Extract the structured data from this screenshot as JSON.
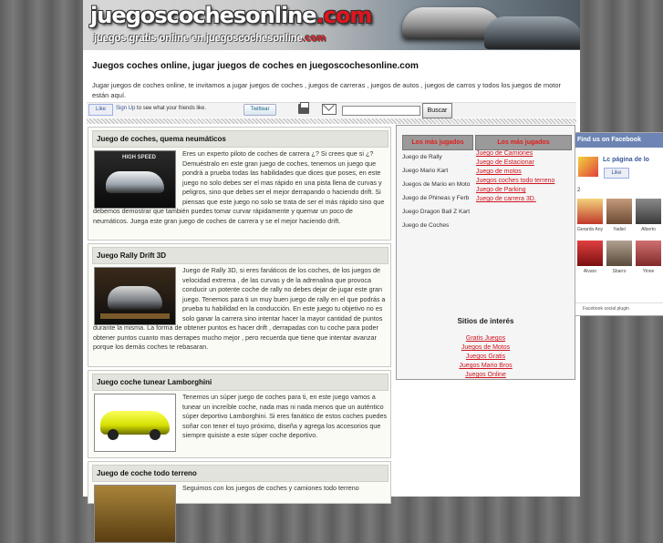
{
  "banner": {
    "logo": "juegoscochesonline",
    "logo_tld": ".com",
    "tagline": "juegos gratis online en juegoscochesonline",
    "tagline_tld": ".com"
  },
  "page_title": "Juegos coches online, jugar juegos de coches en juegoscochesonline.com",
  "intro": "Jugar juegos de coches online, te invitamos a jugar juegos de coches , juegos de carreras , juegos de autos , juegos de carros y todos los juegos de motor están aquí.",
  "social": {
    "like_label": "Like",
    "signup_link": "Sign Up",
    "signup_text": " to see what your friends like.",
    "tweet_label": "Twittear",
    "search_placeholder": "",
    "search_button": "Buscar"
  },
  "cards": [
    {
      "title": "Juego de coches, quema neumáticos",
      "text": "Eres un experto piloto de coches de carrera ¿? Si crees que si ¿? Demuéstralo en este gran juego de coches, tenemos un juego que pondrá a prueba todas las habilidades que dices que poses, en este juego no solo debes ser el mas rápido en una pista llena de curvas y peligros, sino que debes ser el mejor derrapando o haciendo drift. Si piensas que este juego no solo se trata de ser el más rápido sino que debemos demostrar que también puedes tomar curvar rápidamente y quemar un poco de neumáticos. Juega este gran juego de coches de carrera y se el mejor haciendo drift."
    },
    {
      "title": "Juego Rally Drift 3D",
      "text": "Juego de Rally 3D, si eres fanáticos de los coches, de los juegos de velocidad extrema , de las curvas y de la adrenalina que provoca conducir un potente coche de rally no debes dejar de jugar este gran juego. Tenemos para ti un muy buen juego de rally en el que podrás a prueba tu habilidad en la conducción. En este juego tu objetivo no es solo ganar la carrera sino intentar hacer la mayor cantidad de puntos durante la misma. La forma de obtener puntos es hacer drift , derrapadas con tu coche para poder obtener puntos cuanto mas derrapes mucho mejor , pero recuerda que tiene que intentar avanzar porque los demás coches te rebasaran."
    },
    {
      "title": "Juego coche tunear Lamborghini",
      "text": "Tenemos un súper juego de coches para ti, en este juego vamos a tunear un increíble coche, nada mas ni nada menos que un auténtico súper deportivo Lamborghini. Si eres fanático de estos coches puedes soñar con tener el tuyo próximo, diseña y agrega los accesorios que siempre quisiste a este súper coche deportivo."
    },
    {
      "title": "Juego de coche todo terreno",
      "text": "Seguimos con los juegos de coches y camiones todo terreno"
    }
  ],
  "sidebar": {
    "col_a_title": "Los más jugados",
    "col_a_items": [
      "Juego de Rally",
      "Juego Mario Kart",
      "Juegos de Mario en Moto",
      "Juego de Phineas y Ferb",
      "Juego Dragon Ball Z Kart",
      "Juego de Coches"
    ],
    "col_b_title": "Los más jugados",
    "col_b_items": [
      "Juego de Camiones",
      "Juego de Estacionar",
      "Juego de motos",
      "Juegos coches todo terreno",
      "Juego de Parking",
      "Juego de carrera 3D."
    ],
    "sites_title": "Sitios de interés",
    "sites": [
      "Gratis Juegos",
      "Juegos de Motos",
      "Juegos Gratis",
      "Juegos Mario Bros",
      "Juegos Online"
    ]
  },
  "facebook": {
    "header": "Find us on Facebook",
    "page_name": "Lc página de lo",
    "like_label": "Like",
    "count_text": "2",
    "fans": [
      "Gerardo Any",
      "Yadiel",
      "Alberto",
      "Alvaro",
      "Sbarro",
      "Yinne"
    ],
    "footer": "Facebook social plugin"
  },
  "colors": {
    "accent_red": "#e0141e",
    "link_red": "#d0141e",
    "facebook_blue": "#3b5998"
  }
}
